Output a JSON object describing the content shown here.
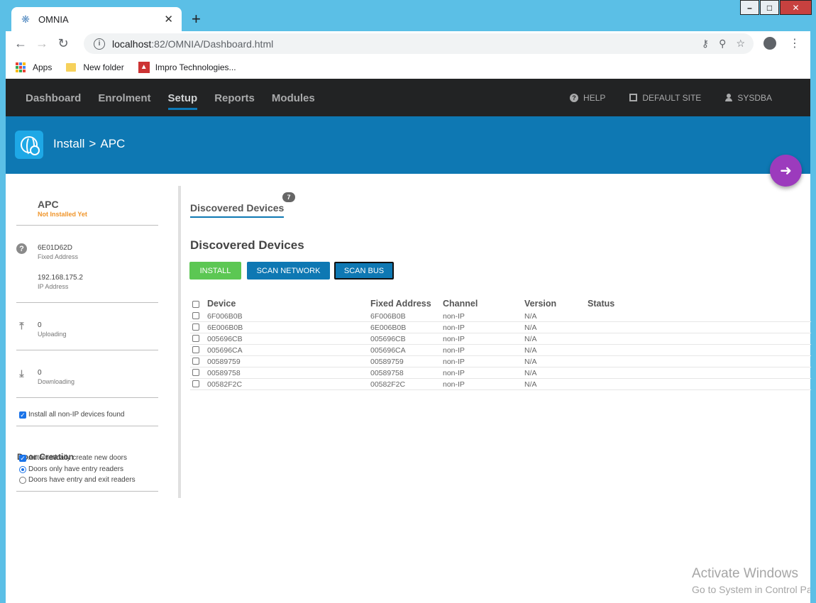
{
  "browser": {
    "tab_title": "OMNIA",
    "url_host": "localhost",
    "url_rest": ":82/OMNIA/Dashboard.html",
    "bookmarks": [
      "Apps",
      "New folder",
      "Impro Technologies..."
    ]
  },
  "nav": {
    "items": [
      "Dashboard",
      "Enrolment",
      "Setup",
      "Reports",
      "Modules"
    ],
    "active": "Setup",
    "help": "HELP",
    "site": "DEFAULT SITE",
    "user": "SYSDBA"
  },
  "banner": {
    "crumb1": "Install",
    "sep": ">",
    "crumb2": "APC"
  },
  "sidebar": {
    "title": "APC",
    "status": "Not Installed Yet",
    "fixed_address_value": "6E01D62D",
    "fixed_address_label": "Fixed Address",
    "ip_value": "192.168.175.2",
    "ip_label": "IP Address",
    "uploading_value": "0",
    "uploading_label": "Uploading",
    "downloading_value": "0",
    "downloading_label": "Downloading",
    "install_all_label": "Install all non-IP devices found",
    "door_creation_title": "Door Creation",
    "auto_create_label": "Automatically create new doors",
    "entry_only_label": "Doors only have entry readers",
    "entry_exit_label": "Doors have entry and exit readers"
  },
  "main": {
    "tab_label": "Discovered Devices",
    "tab_badge": "7",
    "heading": "Discovered Devices",
    "btn_install": "INSTALL",
    "btn_scan_network": "SCAN NETWORK",
    "btn_scan_bus": "SCAN BUS",
    "columns": [
      "Device",
      "Fixed Address",
      "Channel",
      "Version",
      "Status"
    ],
    "rows": [
      {
        "device": "6F006B0B",
        "fixed": "6F006B0B",
        "channel": "non-IP",
        "version": "N/A"
      },
      {
        "device": "6E006B0B",
        "fixed": "6E006B0B",
        "channel": "non-IP",
        "version": "N/A"
      },
      {
        "device": "005696CB",
        "fixed": "005696CB",
        "channel": "non-IP",
        "version": "N/A"
      },
      {
        "device": "005696CA",
        "fixed": "005696CA",
        "channel": "non-IP",
        "version": "N/A"
      },
      {
        "device": "00589759",
        "fixed": "00589759",
        "channel": "non-IP",
        "version": "N/A"
      },
      {
        "device": "00589758",
        "fixed": "00589758",
        "channel": "non-IP",
        "version": "N/A"
      },
      {
        "device": "00582F2C",
        "fixed": "00582F2C",
        "channel": "non-IP",
        "version": "N/A"
      }
    ]
  },
  "watermark": {
    "line1": "Activate Windows",
    "line2": "Go to System in Control Panel to activate Windows."
  },
  "colors": {
    "accent": "#0e78b3",
    "install_green": "#5cc753",
    "back_purple": "#9c3bbd",
    "status_orange": "#f0952a"
  }
}
